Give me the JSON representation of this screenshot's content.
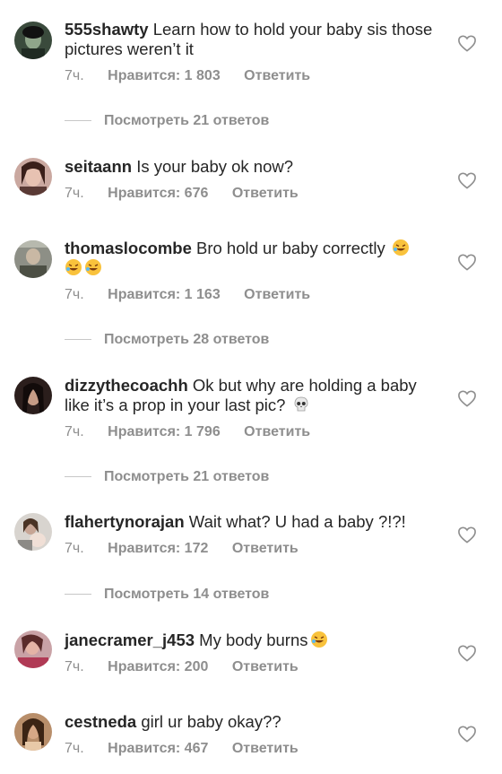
{
  "comments": [
    {
      "username": "555shawty",
      "text": " Learn how to hold your baby sis those pictures weren’t it",
      "time": "7ч.",
      "likes": "Нравится: 1 803",
      "reply": "Ответить",
      "view_replies": "Посмотреть 21 ответов"
    },
    {
      "username": "seitaann",
      "text": " Is your baby ok now?",
      "time": "7ч.",
      "likes": "Нравится: 676",
      "reply": "Ответить"
    },
    {
      "username": "thomaslocombe",
      "text": " Bro hold ur baby correctly",
      "time": "7ч.",
      "likes": "Нравится: 1 163",
      "reply": "Ответить",
      "view_replies": "Посмотреть 28 ответов"
    },
    {
      "username": "dizzythecoachh",
      "text": " Ok but why are holding a baby like it’s a prop in your last pic?",
      "time": "7ч.",
      "likes": "Нравится: 1 796",
      "reply": "Ответить",
      "view_replies": "Посмотреть 21 ответов"
    },
    {
      "username": "flahertynorajan",
      "text": " Wait what?  U had a baby ?!?!",
      "time": "7ч.",
      "likes": "Нравится: 172",
      "reply": "Ответить",
      "view_replies": "Посмотреть 14 ответов"
    },
    {
      "username": "janecramer_j453",
      "text": " My body burns",
      "time": "7ч.",
      "likes": "Нравится: 200",
      "reply": "Ответить"
    },
    {
      "username": "cestneda",
      "text": " girl ur baby okay??",
      "time": "7ч.",
      "likes": "Нравится: 467",
      "reply": "Ответить"
    }
  ],
  "icons": {
    "like": "heart-outline-icon",
    "laugh_emoji": "rolling-on-floor-laughing-emoji",
    "skull_emoji": "skull-emoji"
  },
  "colors": {
    "text": "#262626",
    "secondary": "#8e8e8e",
    "divider": "#c7c7c7"
  }
}
